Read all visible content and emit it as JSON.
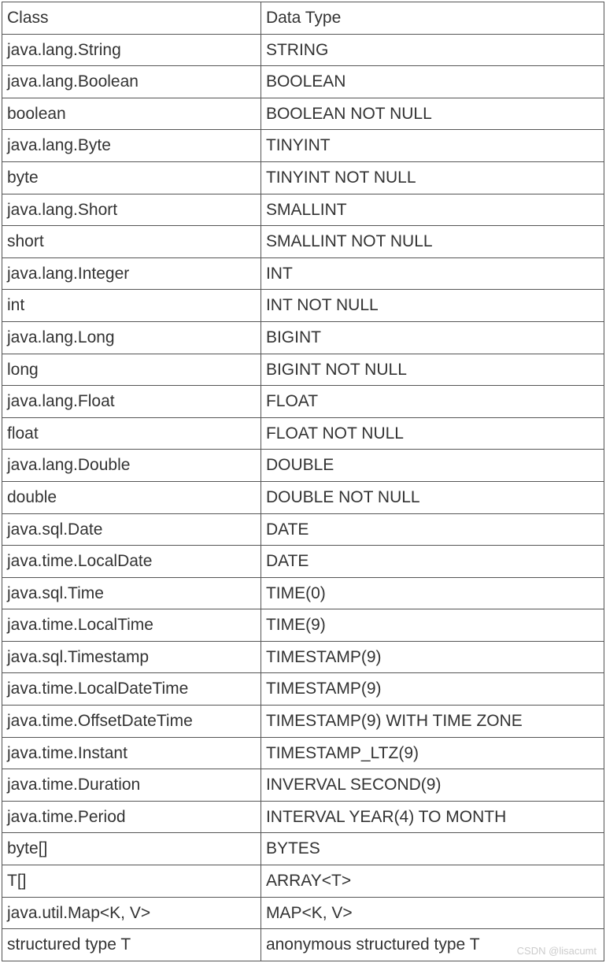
{
  "chart_data": {
    "type": "table",
    "title": "",
    "columns": [
      "Class",
      "Data Type"
    ],
    "rows": [
      [
        "java.lang.String",
        "STRING"
      ],
      [
        "java.lang.Boolean",
        "BOOLEAN"
      ],
      [
        "boolean",
        "BOOLEAN NOT NULL"
      ],
      [
        "java.lang.Byte",
        "TINYINT"
      ],
      [
        "byte",
        "TINYINT NOT NULL"
      ],
      [
        "java.lang.Short",
        "SMALLINT"
      ],
      [
        "short",
        "SMALLINT NOT NULL"
      ],
      [
        "java.lang.Integer",
        "INT"
      ],
      [
        "int",
        "INT NOT NULL"
      ],
      [
        "java.lang.Long",
        "BIGINT"
      ],
      [
        "long",
        "BIGINT NOT NULL"
      ],
      [
        "java.lang.Float",
        "FLOAT"
      ],
      [
        "float",
        "FLOAT NOT NULL"
      ],
      [
        "java.lang.Double",
        "DOUBLE"
      ],
      [
        "double",
        "DOUBLE NOT NULL"
      ],
      [
        "java.sql.Date",
        "DATE"
      ],
      [
        "java.time.LocalDate",
        "DATE"
      ],
      [
        "java.sql.Time",
        "TIME(0)"
      ],
      [
        "java.time.LocalTime",
        "TIME(9)"
      ],
      [
        "java.sql.Timestamp",
        "TIMESTAMP(9)"
      ],
      [
        "java.time.LocalDateTime",
        "TIMESTAMP(9)"
      ],
      [
        "java.time.OffsetDateTime",
        "TIMESTAMP(9) WITH TIME ZONE"
      ],
      [
        "java.time.Instant",
        "TIMESTAMP_LTZ(9)"
      ],
      [
        "java.time.Duration",
        "INVERVAL SECOND(9)"
      ],
      [
        "java.time.Period",
        "INTERVAL YEAR(4) TO MONTH"
      ],
      [
        "byte[]",
        "BYTES"
      ],
      [
        "T[]",
        "ARRAY<T>"
      ],
      [
        "java.util.Map<K, V>",
        "MAP<K, V>"
      ],
      [
        "structured type T",
        "anonymous structured type T"
      ]
    ]
  },
  "watermark": "CSDN @lisacumt"
}
